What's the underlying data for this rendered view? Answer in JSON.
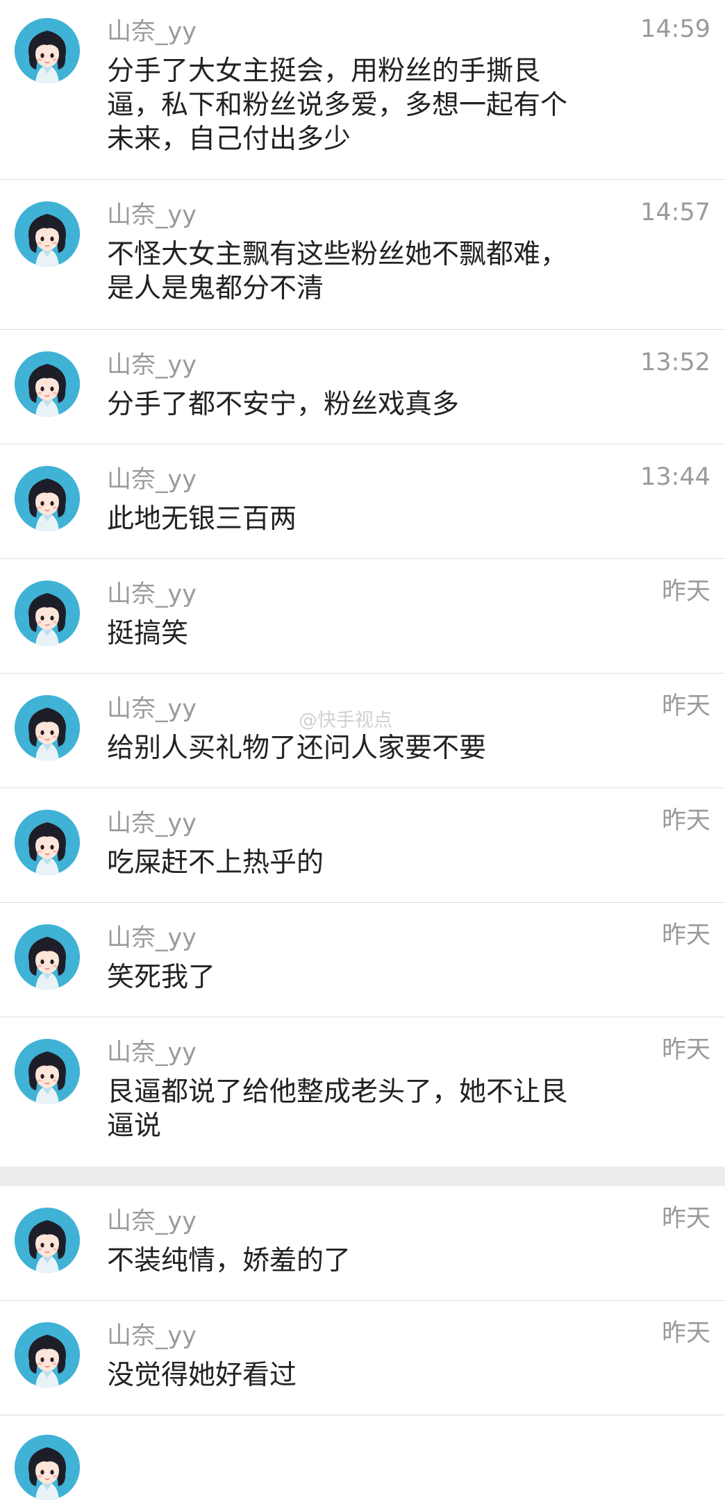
{
  "comments": [
    {
      "name": "山奈_yy",
      "time": "14:59",
      "text": "分手了大女主挺会，用粉丝的手撕艮\n逼，私下和粉丝说多爱，多想一起有个\n未来，自己付出多少"
    },
    {
      "name": "山奈_yy",
      "time": "14:57",
      "text": "不怪大女主飘有这些粉丝她不飘都难，\n是人是鬼都分不清"
    },
    {
      "name": "山奈_yy",
      "time": "13:52",
      "text": "分手了都不安宁，粉丝戏真多"
    },
    {
      "name": "山奈_yy",
      "time": "13:44",
      "text": "此地无银三百两"
    },
    {
      "name": "山奈_yy",
      "time": "昨天",
      "text": "挺搞笑"
    },
    {
      "name": "山奈_yy",
      "time": "昨天",
      "text": "给别人买礼物了还问人家要不要"
    },
    {
      "name": "山奈_yy",
      "time": "昨天",
      "text": "吃屎赶不上热乎的"
    },
    {
      "name": "山奈_yy",
      "time": "昨天",
      "text": "笑死我了"
    },
    {
      "name": "山奈_yy",
      "time": "昨天",
      "text": "艮逼都说了给他整成老头了，她不让艮\n逼说"
    },
    {
      "name": "山奈_yy",
      "time": "昨天",
      "text": "不装纯情，娇羞的了"
    },
    {
      "name": "山奈_yy",
      "time": "昨天",
      "text": "没觉得她好看过"
    }
  ],
  "watermark": "@快手视点",
  "colors": {
    "avatar_bg": "#3fb2d6",
    "separator": "#dedede",
    "gap": "#ececec",
    "meta_text": "#9a9a9a",
    "body_text": "#222222"
  }
}
